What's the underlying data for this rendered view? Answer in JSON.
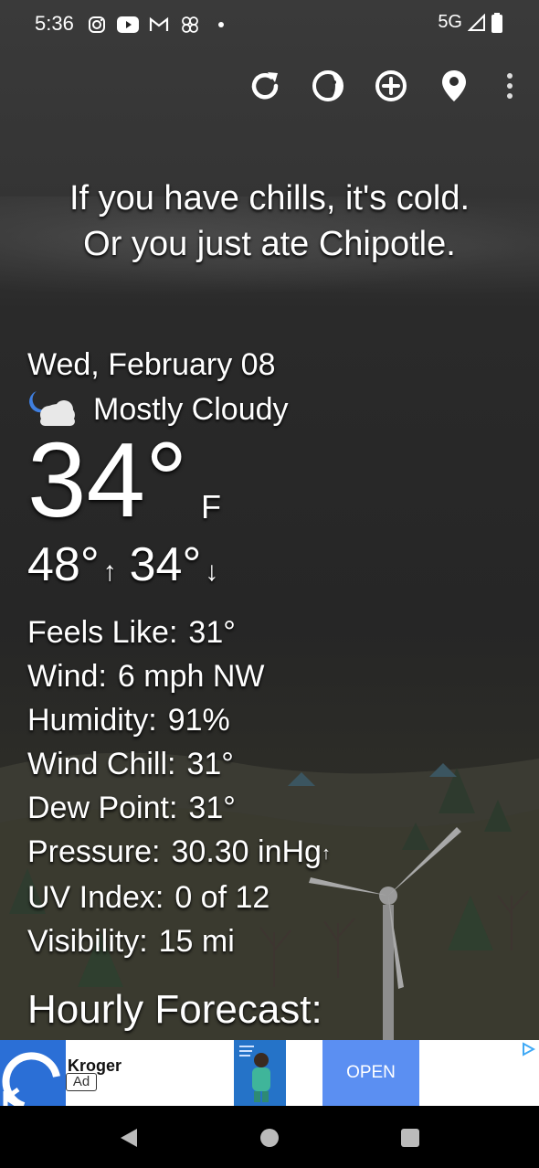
{
  "status_bar": {
    "time": "5:36",
    "network": "5G",
    "left_icons": [
      "instagram-icon",
      "youtube-icon",
      "gmail-icon",
      "pinwheel-icon",
      "dot-icon"
    ],
    "right_icons": [
      "signal-icon",
      "battery-icon"
    ]
  },
  "toolbar": {
    "icons": [
      "refresh-icon",
      "moon-phase-icon",
      "add-location-icon",
      "location-pin-icon",
      "more-vert-icon"
    ]
  },
  "quote": {
    "line1": "If you have chills, it's cold.",
    "line2": "Or you just ate Chipotle."
  },
  "weather": {
    "date": "Wed, February 08",
    "condition": "Mostly Cloudy",
    "condition_icon": "moon-cloud-icon",
    "temperature": "34°",
    "unit": "F",
    "high": "48°",
    "high_arrow": "↑",
    "low": "34°",
    "low_arrow": "↓"
  },
  "details": [
    {
      "label": "Feels Like:",
      "value": "31°"
    },
    {
      "label": "Wind:",
      "value": "6 mph NW"
    },
    {
      "label": "Humidity:",
      "value": "91%"
    },
    {
      "label": "Wind Chill:",
      "value": "31°"
    },
    {
      "label": "Dew Point:",
      "value": "31°"
    },
    {
      "label": "Pressure:",
      "value": "30.30 inHg",
      "trend": "↑"
    },
    {
      "label": "UV Index:",
      "value": "0 of 12"
    },
    {
      "label": "Visibility:",
      "value": "15 mi"
    }
  ],
  "hourly_title": "Hourly Forecast:",
  "ad": {
    "brand": "Kroger",
    "tag": "Ad",
    "cta": "OPEN",
    "colors": {
      "brand_blue": "#2b6fd6",
      "cta_blue": "#5b8ff2"
    }
  },
  "nav_bar": {
    "icons": [
      "back-icon",
      "home-icon",
      "recents-icon"
    ]
  }
}
